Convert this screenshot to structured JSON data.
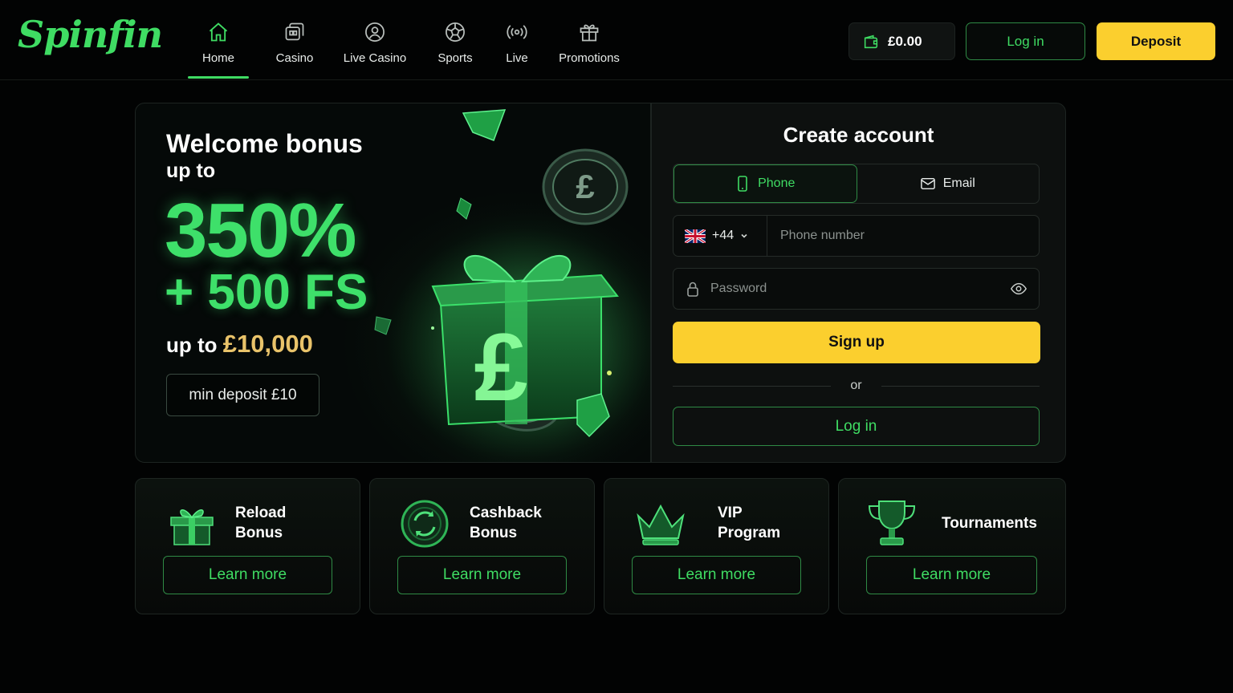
{
  "brand": {
    "logo": "Spinfin",
    "accent": "#3fdc63",
    "cta": "#fbcf2e"
  },
  "nav": [
    {
      "label": "Home",
      "icon": "home-icon",
      "active": true
    },
    {
      "label": "Casino",
      "icon": "casino-icon"
    },
    {
      "label": "Live Casino",
      "icon": "live-casino-icon"
    },
    {
      "label": "Sports",
      "icon": "football-icon"
    },
    {
      "label": "Live",
      "icon": "live-broadcast-icon"
    },
    {
      "label": "Promotions",
      "icon": "gift-icon"
    }
  ],
  "header": {
    "balance": "£0.00",
    "login_label": "Log in",
    "deposit_label": "Deposit"
  },
  "hero": {
    "title": "Welcome bonus",
    "subtitle": "up to",
    "percent": "350%",
    "free_spins": "+ 500 FS",
    "upto_prefix": "up to",
    "upto_amount": "£10,000",
    "min_deposit": "min deposit £10"
  },
  "signup": {
    "title": "Create account",
    "tabs": [
      {
        "label": "Phone",
        "icon": "phone-icon",
        "active": true
      },
      {
        "label": "Email",
        "icon": "mail-icon"
      }
    ],
    "country_code": "+44",
    "phone_placeholder": "Phone number",
    "password_placeholder": "Password",
    "signup_label": "Sign up",
    "or_label": "or",
    "login_label": "Log in"
  },
  "promos": [
    {
      "title1": "Reload",
      "title2": "Bonus",
      "icon": "gift-box-icon",
      "button": "Learn more"
    },
    {
      "title1": "Cashback",
      "title2": "Bonus",
      "icon": "refresh-coin-icon",
      "button": "Learn more"
    },
    {
      "title1": "VIP",
      "title2": "Program",
      "icon": "crown-icon",
      "button": "Learn more"
    },
    {
      "title1": "Tournaments",
      "title2": "",
      "icon": "trophy-icon",
      "button": "Learn more"
    }
  ]
}
